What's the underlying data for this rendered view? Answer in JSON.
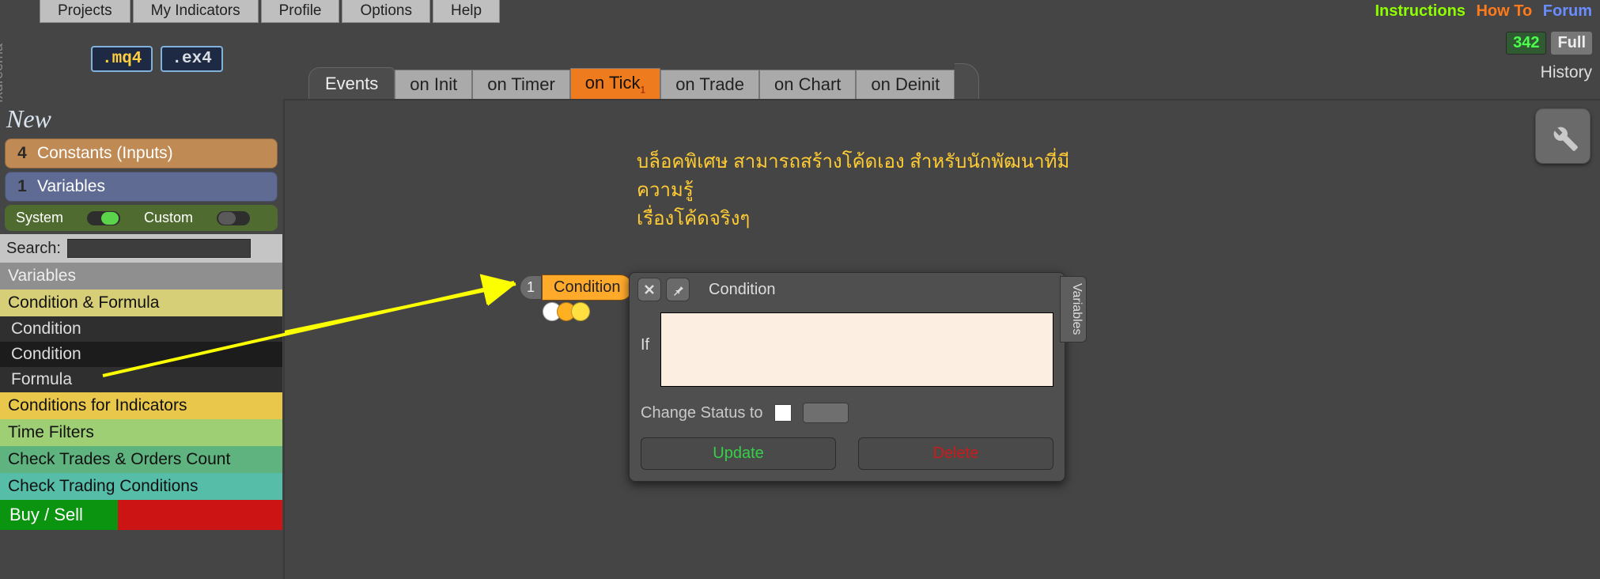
{
  "brand": "fxdreema",
  "menu": [
    "Projects",
    "My Indicators",
    "Profile",
    "Options",
    "Help"
  ],
  "links": {
    "instructions": "Instructions",
    "howto": "How To",
    "forum": "Forum"
  },
  "badge": {
    "num": "342",
    "full": "Full"
  },
  "history": "History",
  "filebtns": {
    "mq4": ".mq4",
    "ex4": ".ex4"
  },
  "eventtabs": {
    "main": "Events",
    "items": [
      "on Init",
      "on Timer",
      "on Tick",
      "on Trade",
      "on Chart",
      "on Deinit"
    ],
    "active": "on Tick",
    "active_badge": "1"
  },
  "left": {
    "new": "New",
    "constants": {
      "count": "4",
      "label": "Constants (Inputs)"
    },
    "variables": {
      "count": "1",
      "label": "Variables"
    },
    "system": "System",
    "custom": "Custom",
    "search": "Search:",
    "cats": {
      "variables": "Variables",
      "condformula": "Condition & Formula",
      "sub": [
        "Condition",
        "Condition",
        "Formula"
      ],
      "indicators": "Conditions for Indicators",
      "time": "Time Filters",
      "trades": "Check Trades & Orders Count",
      "trading": "Check Trading Conditions",
      "buy": "Buy / Sell"
    }
  },
  "canvas": {
    "thai_line1": "บล็อคพิเศษ สามารถสร้างโค้ดเอง สำหรับนักพัฒนาที่มีความรู้",
    "thai_line2": "เรื่องโค้ดจริงๆ",
    "node_num": "1",
    "node_label": "Condition"
  },
  "panel": {
    "title": "Condition",
    "if": "If",
    "status": "Change Status to",
    "update": "Update",
    "delete": "Delete",
    "sidetab": "Variables"
  }
}
